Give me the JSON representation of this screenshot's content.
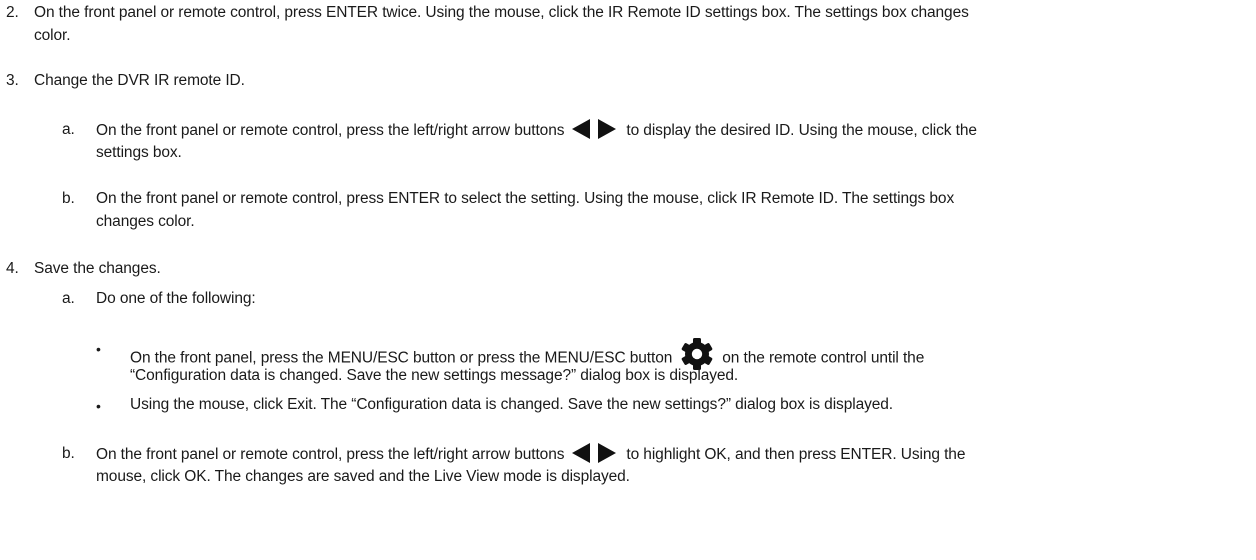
{
  "step2": {
    "num": "2.",
    "line1": "On the front panel or remote control, press ENTER twice. Using the mouse, click the IR Remote ID settings box. The settings box changes",
    "line2": "color."
  },
  "step3": {
    "num": "3.",
    "text": "Change the DVR IR remote ID.",
    "a": {
      "label": "a.",
      "line1_pre": "On the front panel or remote control, press the left/right arrow buttons",
      "line1_post": "to display the desired ID. Using the mouse, click the",
      "line2": "settings box."
    },
    "b": {
      "label": "b.",
      "line1": "On the front panel or remote control, press ENTER to select the setting. Using the mouse, click IR Remote ID. The settings box",
      "line2": "changes color."
    }
  },
  "step4": {
    "num": "4.",
    "text": "Save the changes.",
    "a": {
      "label": "a.",
      "text": "Do one of the following:",
      "bullet1_pre": "On the front panel, press the MENU/ESC button or press the MENU/ESC button",
      "bullet1_post": "on the remote control until the",
      "bullet1_line2": "“Configuration data is changed. Save the new settings message?” dialog box is displayed.",
      "bullet2": "Using the mouse, click Exit. The “Configuration data is changed. Save the new settings?” dialog box is displayed."
    },
    "b": {
      "label": "b.",
      "line1_pre": "On the front panel or remote control, press the left/right arrow buttons",
      "line1_post": "to highlight OK, and then press ENTER. Using the",
      "line2": "mouse, click OK. The changes are saved and the Live View mode is displayed."
    }
  },
  "bullet_char": "•",
  "icons": [
    "left-arrow-icon",
    "right-arrow-icon",
    "gear-icon"
  ]
}
